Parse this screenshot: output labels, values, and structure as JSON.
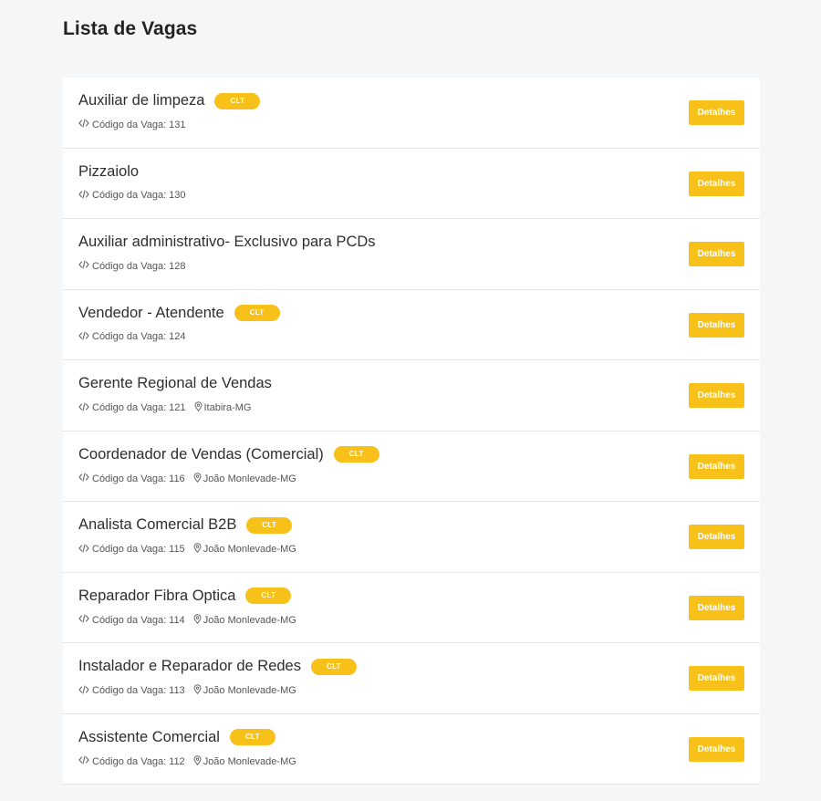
{
  "page": {
    "title": "Lista de Vagas"
  },
  "labels": {
    "code_prefix": "Código da Vaga:",
    "details_button": "Detalhes"
  },
  "colors": {
    "accent": "#f7c11a",
    "background": "#f5f6f8",
    "card": "#ffffff"
  },
  "jobs": [
    {
      "title": "Auxiliar de limpeza",
      "badge": "CLT",
      "code": "131",
      "location": ""
    },
    {
      "title": "Pizzaiolo",
      "badge": "",
      "code": "130",
      "location": ""
    },
    {
      "title": "Auxiliar administrativo- Exclusivo para PCDs",
      "badge": "",
      "code": "128",
      "location": ""
    },
    {
      "title": "Vendedor - Atendente",
      "badge": "CLT",
      "code": "124",
      "location": ""
    },
    {
      "title": "Gerente Regional de Vendas",
      "badge": "",
      "code": "121",
      "location": "Itabira-MG"
    },
    {
      "title": "Coordenador de Vendas (Comercial)",
      "badge": "CLT",
      "code": "116",
      "location": "João Monlevade-MG"
    },
    {
      "title": "Analista Comercial B2B",
      "badge": "CLT",
      "code": "115",
      "location": "João Monlevade-MG"
    },
    {
      "title": "Reparador Fibra Optica",
      "badge": "CLT",
      "code": "114",
      "location": "João Monlevade-MG"
    },
    {
      "title": "Instalador e Reparador de Redes",
      "badge": "CLT",
      "code": "113",
      "location": "João Monlevade-MG"
    },
    {
      "title": "Assistente Comercial",
      "badge": "CLT",
      "code": "112",
      "location": "João Monlevade-MG"
    }
  ]
}
